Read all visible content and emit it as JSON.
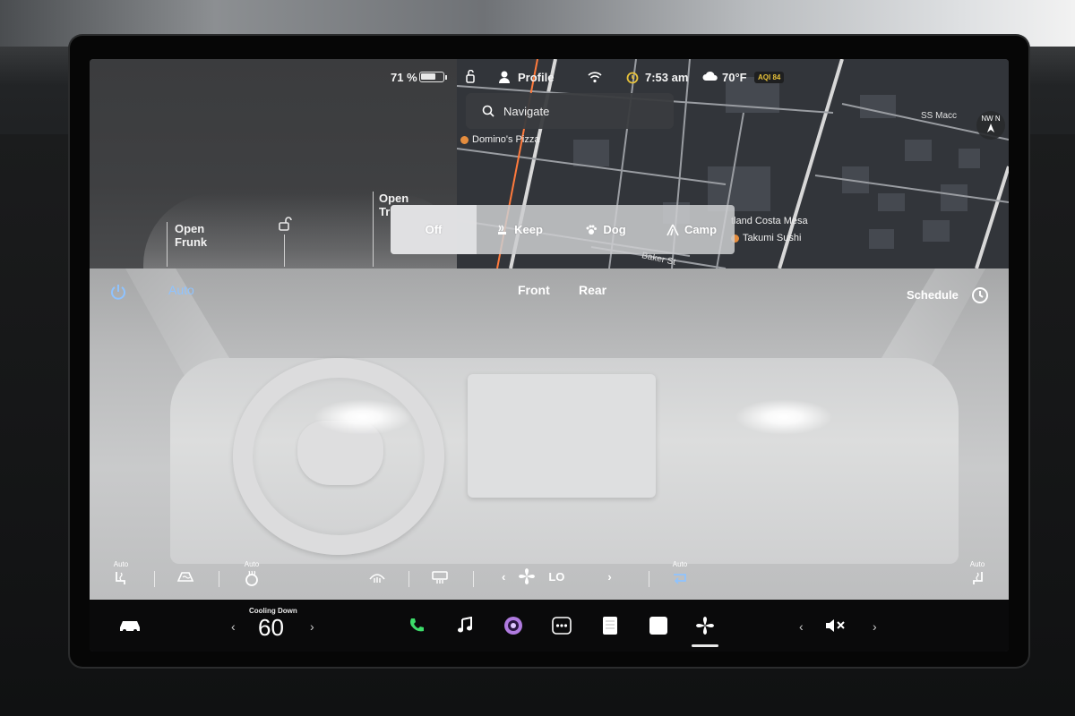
{
  "status": {
    "battery_pct": "71 %",
    "battery_level": 0.71,
    "profile": "Profile",
    "time": "7:53 am",
    "temperature": "70°F",
    "aqi": "AQI 84"
  },
  "map": {
    "search_label": "Navigate",
    "pois": [
      "Domino's Pizza",
      "tland Costa Mesa",
      "Takumi Sushi"
    ],
    "streets": [
      "Baker St",
      "SS Macc"
    ],
    "compass": "NW N"
  },
  "car": {
    "frunk_line1": "Open",
    "frunk_line2": "Frunk",
    "trunk_line1": "Open",
    "trunk_line2": "Tr"
  },
  "modes": {
    "items": [
      {
        "label": "Off",
        "icon": ""
      },
      {
        "label": "Keep",
        "icon": "keep-icon"
      },
      {
        "label": "Dog",
        "icon": "paw-icon"
      },
      {
        "label": "Camp",
        "icon": "tent-icon"
      }
    ]
  },
  "climate": {
    "auto_label": "Auto",
    "front_label": "Front",
    "rear_label": "Rear",
    "schedule_label": "Schedule",
    "auto_badge": "Auto",
    "fan_level": "LO"
  },
  "dock": {
    "temp_caption": "Cooling Down",
    "temp_value": "60"
  },
  "colors": {
    "accent_blue": "#8fc3ff",
    "phone_green": "#3ddc6a",
    "media_purple": "#b07be0",
    "clock_yellow": "#e7c23a"
  }
}
